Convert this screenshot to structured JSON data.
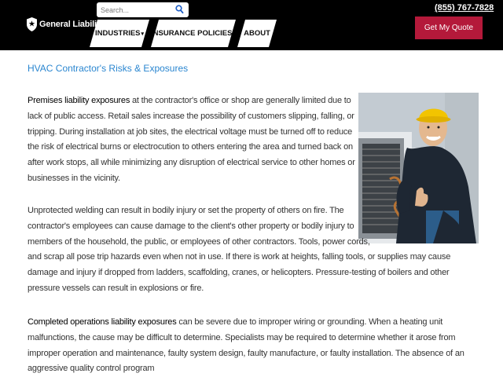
{
  "header": {
    "brand": "General Liability",
    "search_placeholder": "Search...",
    "nav": [
      {
        "label": "INDUSTRIES",
        "caret": "▾"
      },
      {
        "label": "INSURANCE POLICIES",
        "caret": "▾"
      },
      {
        "label": "ABOUT",
        "caret": ""
      }
    ],
    "phone": "(855) 767-7828",
    "cta": "Get My Quote"
  },
  "article": {
    "title": "HVAC Contractor's Risks & Exposures",
    "p1_lead": "Premises liability exposures",
    "p1_text": " at the contractor's office or shop are generally limited due to lack of public access. Retail sales increase the possibility of customers slipping, falling, or tripping. During installation at job sites, the electrical voltage must be turned off to reduce the risk of electrical burns or electrocution to others entering the area and turned back on after work stops, all while minimizing any disruption of electrical service to other homes or businesses in the vicinity.",
    "p2_line1": "Unprotected welding can result in bodily injury or set the property of others on fire. The",
    "p2_line2": "contractor's employees can cause damage to the client's other property or bodily injury to",
    "p2_line3": "members of the household, the public, or employees of other contractors. Tools, power cords,",
    "p2_rest": "and scrap all pose trip hazards even when not in use. If there is work at heights, falling tools, or supplies may cause damage and injury if dropped from ladders, scaffolding, cranes, or helicopters. Pressure-testing of boilers and other pressure vessels can result in explosions or fire.",
    "p3_lead": "Completed operations liability exposures",
    "p3_text": " can be severe due to improper wiring or grounding. When a heating unit malfunctions, the cause may be difficult to determine. Specialists may be required to determine whether it arose from improper operation and maintenance, faulty system design, faulty manufacture, or faulty installation. The absence of an aggressive quality control program"
  },
  "colors": {
    "header_bg": "#000000",
    "title": "#2a86d0",
    "cta_bg": "#b4193a"
  }
}
